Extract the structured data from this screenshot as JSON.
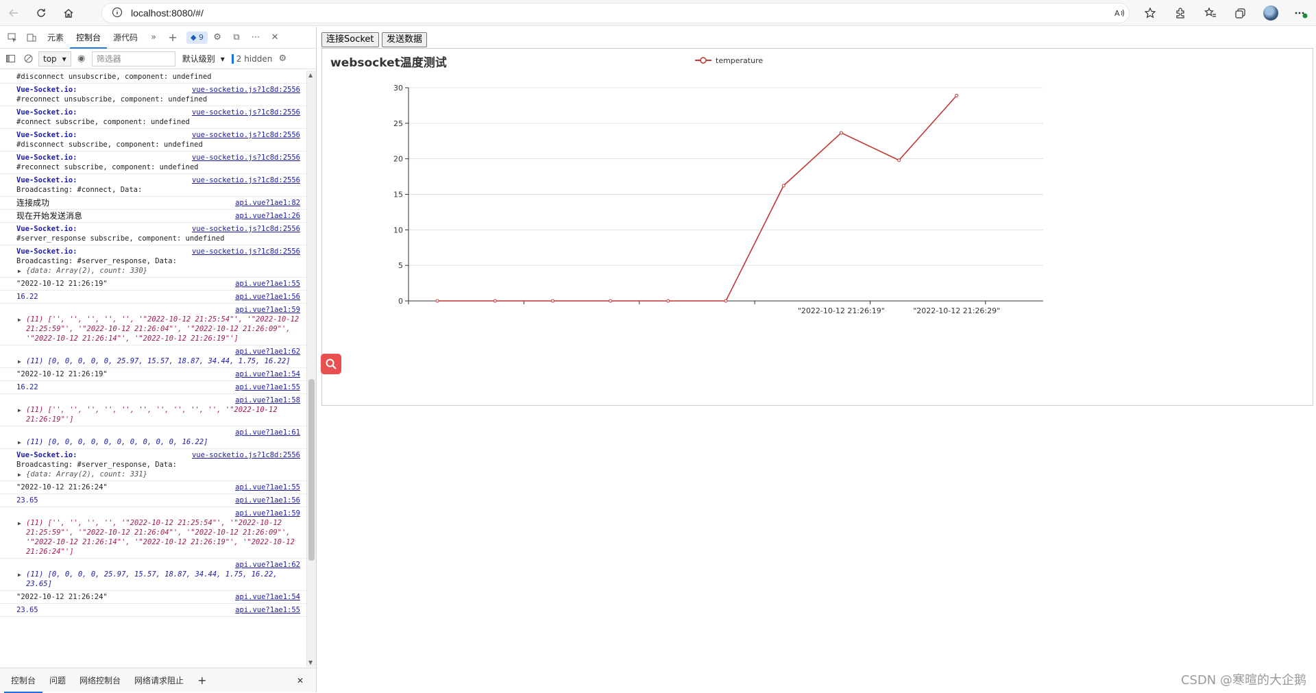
{
  "browser": {
    "url": "localhost:8080/#/"
  },
  "devtools": {
    "tabs": [
      "元素",
      "控制台",
      "源代码"
    ],
    "badge_count": "9",
    "context": "top",
    "filter_placeholder": "筛选器",
    "level": "默认级别",
    "hidden": "2 hidden",
    "bottom_tabs": [
      "控制台",
      "问题",
      "网络控制台",
      "网络请求阻止"
    ],
    "messages": [
      {
        "kind": "text",
        "lines": [
          "#disconnect unsubscribe, component: undefined"
        ]
      },
      {
        "kind": "socket",
        "head": "Vue-Socket.io:",
        "src": "vue-socketio.js?1c8d:2556",
        "lines": [
          "#reconnect unsubscribe, component: undefined"
        ]
      },
      {
        "kind": "socket",
        "head": "Vue-Socket.io:",
        "src": "vue-socketio.js?1c8d:2556",
        "lines": [
          "#connect subscribe, component: undefined"
        ]
      },
      {
        "kind": "socket",
        "head": "Vue-Socket.io:",
        "src": "vue-socketio.js?1c8d:2556",
        "lines": [
          "#disconnect subscribe, component: undefined"
        ]
      },
      {
        "kind": "socket",
        "head": "Vue-Socket.io:",
        "src": "vue-socketio.js?1c8d:2556",
        "lines": [
          "#reconnect subscribe, component: undefined"
        ]
      },
      {
        "kind": "socket",
        "head": "Vue-Socket.io:",
        "src": "vue-socketio.js?1c8d:2556",
        "lines": [
          "Broadcasting: #connect, Data:"
        ]
      },
      {
        "kind": "cjk",
        "text": "连接成功",
        "src": "api.vue?1ae1:82"
      },
      {
        "kind": "cjk",
        "text": "现在开始发送消息",
        "src": "api.vue?1ae1:26"
      },
      {
        "kind": "socket",
        "head": "Vue-Socket.io:",
        "src": "vue-socketio.js?1c8d:2556",
        "lines": [
          "#server_response subscribe, component: undefined"
        ]
      },
      {
        "kind": "socket",
        "head": "Vue-Socket.io:",
        "src": "vue-socketio.js?1c8d:2556",
        "lines": [
          "Broadcasting: #server_response, Data:"
        ],
        "obj": "{data: Array(2), count: 330}"
      },
      {
        "kind": "str",
        "text": "\"2022-10-12 21:26:19\"",
        "src": "api.vue?1ae1:55"
      },
      {
        "kind": "num",
        "text": "16.22",
        "src": "api.vue?1ae1:56"
      },
      {
        "kind": "arr",
        "src": "api.vue?1ae1:59",
        "obj": "(11) ['', '', '', '', '', '\"2022-10-12 21:25:54\"', '\"2022-10-12 21:25:59\"', '\"2022-10-12 21:26:04\"', '\"2022-10-12 21:26:09\"', '\"2022-10-12 21:26:14\"', '\"2022-10-12 21:26:19\"']",
        "style": "c"
      },
      {
        "kind": "arr",
        "src": "api.vue?1ae1:62",
        "obj": "(11) [0, 0, 0, 0, 0, 25.97, 15.57, 18.87, 34.44, 1.75, 16.22]",
        "style": "b"
      },
      {
        "kind": "str",
        "text": "\"2022-10-12 21:26:19\"",
        "src": "api.vue?1ae1:54"
      },
      {
        "kind": "num",
        "text": "16.22",
        "src": "api.vue?1ae1:55"
      },
      {
        "kind": "arr",
        "src": "api.vue?1ae1:58",
        "obj": "(11) ['', '', '', '', '', '', '', '', '', '', '\"2022-10-12 21:26:19\"']",
        "style": "c"
      },
      {
        "kind": "arr1",
        "src": "api.vue?1ae1:61",
        "obj": "(11) [0, 0, 0, 0, 0, 0, 0, 0, 0, 0, 16.22]",
        "style": "b"
      },
      {
        "kind": "socket",
        "head": "Vue-Socket.io:",
        "src": "vue-socketio.js?1c8d:2556",
        "lines": [
          "Broadcasting: #server_response, Data:"
        ],
        "obj": "{data: Array(2), count: 331}"
      },
      {
        "kind": "str",
        "text": "\"2022-10-12 21:26:24\"",
        "src": "api.vue?1ae1:55"
      },
      {
        "kind": "num",
        "text": "23.65",
        "src": "api.vue?1ae1:56"
      },
      {
        "kind": "arr",
        "src": "api.vue?1ae1:59",
        "obj": "(11) ['', '', '', '', '\"2022-10-12 21:25:54\"', '\"2022-10-12 21:25:59\"', '\"2022-10-12 21:26:04\"', '\"2022-10-12 21:26:09\"', '\"2022-10-12 21:26:14\"', '\"2022-10-12 21:26:19\"', '\"2022-10-12 21:26:24\"']",
        "style": "c"
      },
      {
        "kind": "arr",
        "src": "api.vue?1ae1:62",
        "obj": "(11) [0, 0, 0, 0, 25.97, 15.57, 18.87, 34.44, 1.75, 16.22, 23.65]",
        "style": "b"
      },
      {
        "kind": "str",
        "text": "\"2022-10-12 21:26:24\"",
        "src": "api.vue?1ae1:54"
      },
      {
        "kind": "num",
        "text": "23.65",
        "src": "api.vue?1ae1:55"
      }
    ]
  },
  "page": {
    "connect_button": "连接Socket",
    "send_button": "发送数据"
  },
  "chart_data": {
    "type": "line",
    "title": "websocket温度测试",
    "legend": "temperature",
    "legend_position": "top-center",
    "grid": true,
    "ylim": [
      0,
      30
    ],
    "yticks": [
      0,
      5,
      10,
      15,
      20,
      25,
      30
    ],
    "x": [
      "",
      "",
      "",
      "",
      "",
      "",
      "",
      "\"2022-10-12 21:26:19\"",
      "",
      "\"2022-10-12 21:26:29\"",
      ""
    ],
    "series": [
      {
        "name": "temperature",
        "color": "#c23531",
        "values": [
          0,
          0,
          0,
          0,
          0,
          0,
          16.22,
          23.65,
          19.8,
          28.9
        ]
      }
    ]
  },
  "watermark": "CSDN @寒暄的大企鹅"
}
